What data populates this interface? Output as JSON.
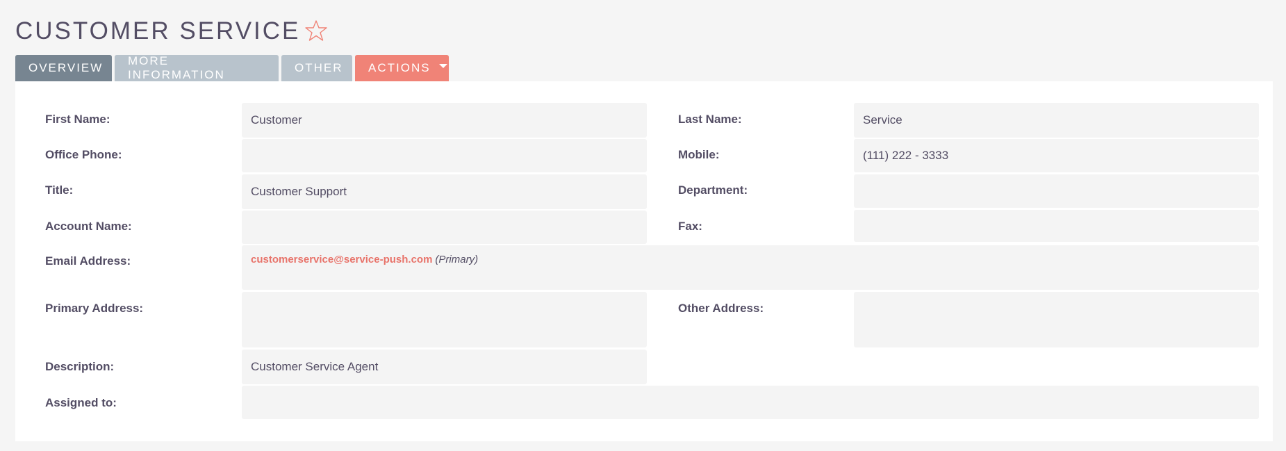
{
  "header": {
    "title": "CUSTOMER SERVICE",
    "favorite_icon": "star-outline-icon",
    "favorite_color": "#f08377"
  },
  "tabs": [
    {
      "label": "OVERVIEW",
      "active": true
    },
    {
      "label": "MORE INFORMATION",
      "active": false
    },
    {
      "label": "OTHER",
      "active": false
    },
    {
      "label": "ACTIONS",
      "active": false,
      "has_dropdown": true
    }
  ],
  "fields": {
    "first_name": {
      "label": "First Name:",
      "value": "Customer"
    },
    "last_name": {
      "label": "Last Name:",
      "value": "Service"
    },
    "office_phone": {
      "label": "Office Phone:",
      "value": ""
    },
    "mobile": {
      "label": "Mobile:",
      "value": "(111) 222 - 3333"
    },
    "title": {
      "label": "Title:",
      "value": "Customer Support"
    },
    "department": {
      "label": "Department:",
      "value": ""
    },
    "account_name": {
      "label": "Account Name:",
      "value": ""
    },
    "fax": {
      "label": "Fax:",
      "value": ""
    },
    "email_address": {
      "label": "Email Address:",
      "value": "customerservice@service-push.com",
      "qualifier": "(Primary)"
    },
    "primary_address": {
      "label": "Primary Address:",
      "value": ""
    },
    "other_address": {
      "label": "Other Address:",
      "value": ""
    },
    "description": {
      "label": "Description:",
      "value": "Customer Service Agent"
    },
    "assigned_to": {
      "label": "Assigned to:",
      "value": ""
    }
  },
  "colors": {
    "tab_active": "#778591",
    "tab_inactive": "#b8c3cc",
    "tab_actions": "#f08377",
    "link": "#e8736a",
    "field_bg": "#f4f4f4",
    "page_bg": "#f5f5f5"
  }
}
